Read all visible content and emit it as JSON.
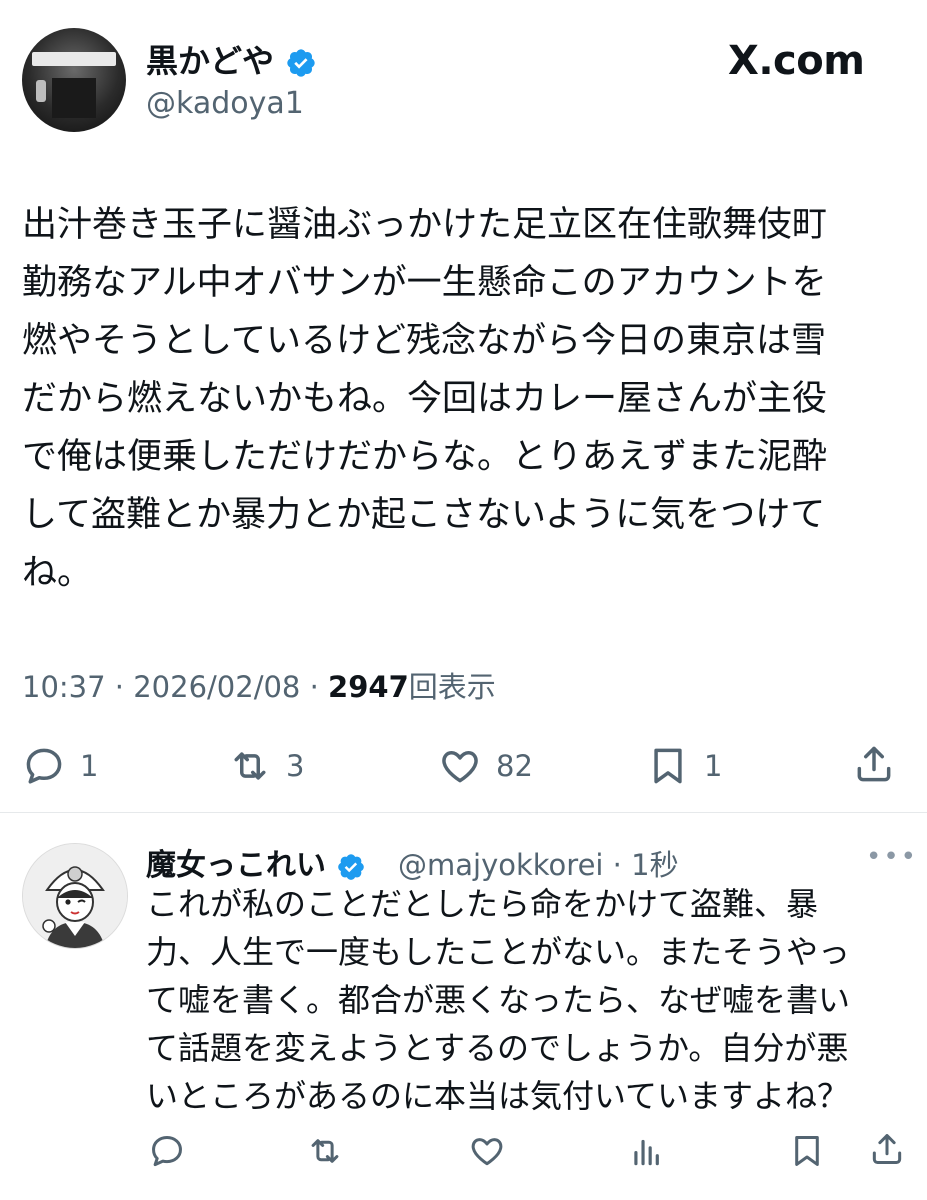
{
  "tweet": {
    "display_name": "黒かどや",
    "handle": "@kadoya1",
    "brand": "X.com",
    "text": "出汁巻き玉子に醤油ぶっかけた足立区在住歌舞伎町\n勤務なアル中オバサンが一生懸命このアカウントを\n燃やそうとしているけど残念ながら今日の東京は雪\nだから燃えないかもね。今回はカレー屋さんが主役\nで俺は便乗しただけだからな。とりあえずまた泥酔\nして盗難とか暴力とか起こさないように気をつけて\nね。",
    "time": "10:37",
    "date": "2026/02/08",
    "separator": "·",
    "views": "2947",
    "views_label": "回表示",
    "stats": {
      "replies": "1",
      "retweets": "3",
      "likes": "82",
      "bookmarks": "1"
    }
  },
  "reply": {
    "display_name": "魔女っこれい",
    "handle_meta": "@majyokkorei · 1秒",
    "more": "•••",
    "text": "これが私のことだとしたら命をかけて盗難、暴\n力、人生で一度もしたことがない。またそうやっ\nて嘘を書く。都合が悪くなったら、なぜ嘘を書い\nて話題を変えようとするのでしょうか。自分が悪\nいところがあるのに本当は気付いていますよね？"
  },
  "colors": {
    "verified": "#1d9bf0",
    "secondary_text": "#536471",
    "primary_text": "#0f1419"
  }
}
